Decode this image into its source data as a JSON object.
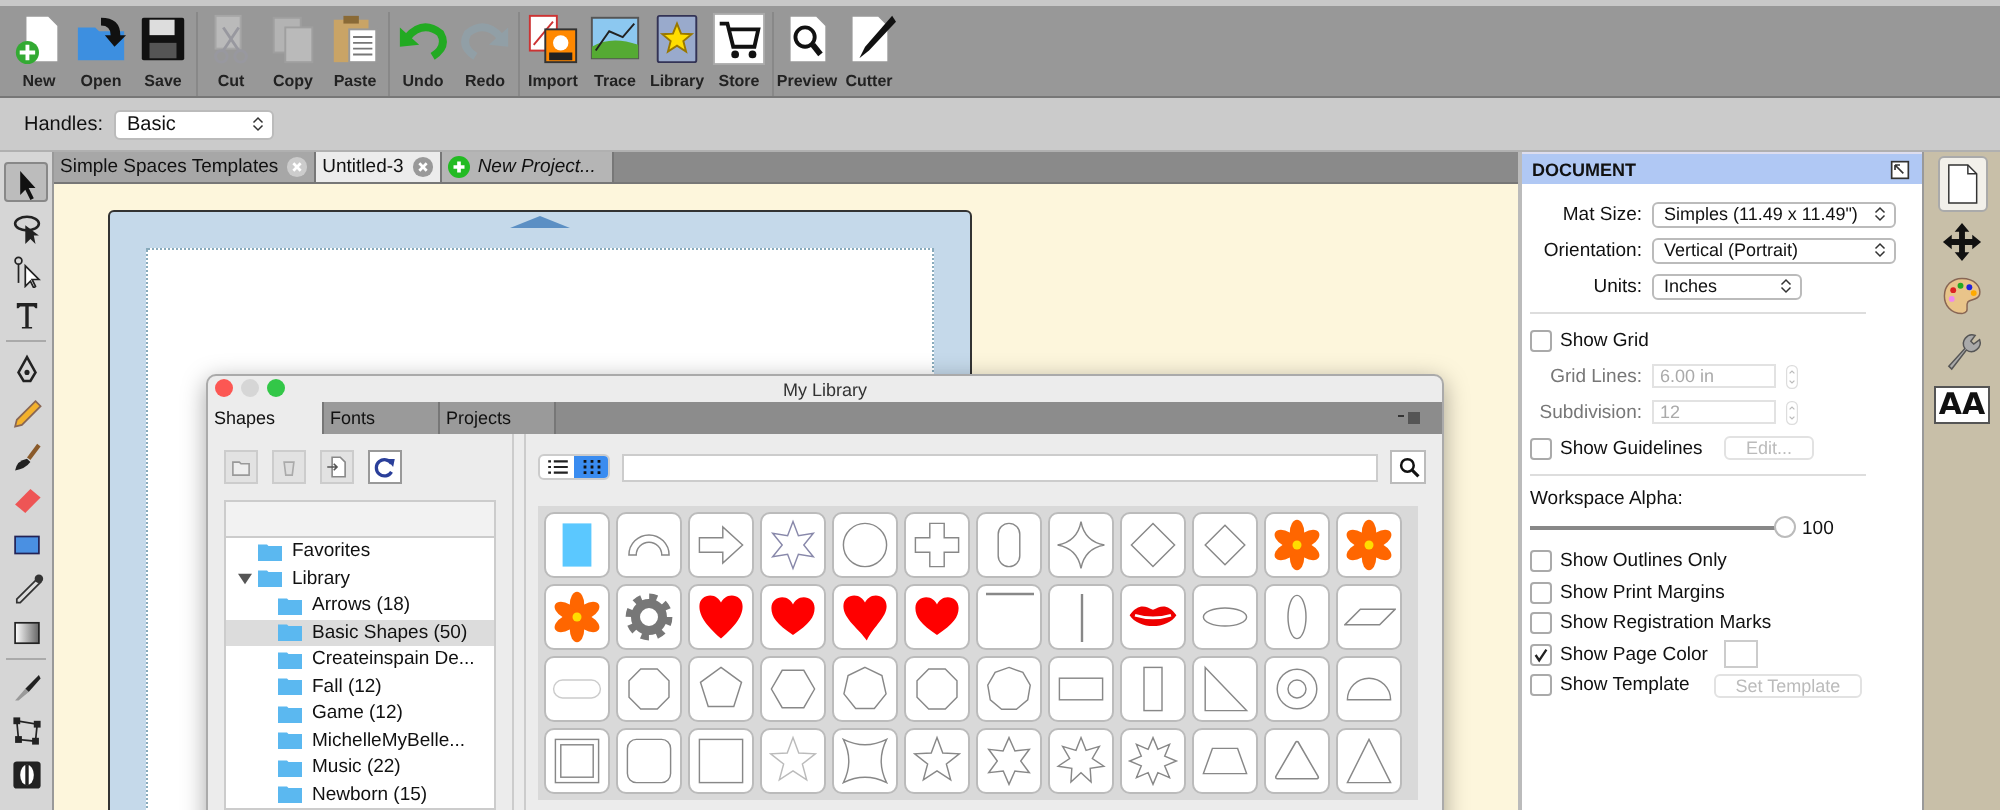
{
  "toolbar": [
    {
      "label": "New",
      "kind": "new",
      "disabled": false
    },
    {
      "label": "Open",
      "kind": "open",
      "disabled": false
    },
    {
      "label": "Save",
      "kind": "save",
      "disabled": false
    },
    {
      "label": "Cut",
      "kind": "cut",
      "disabled": true
    },
    {
      "label": "Copy",
      "kind": "copy",
      "disabled": true
    },
    {
      "label": "Paste",
      "kind": "paste",
      "disabled": false
    },
    {
      "label": "Undo",
      "kind": "undo",
      "disabled": false
    },
    {
      "label": "Redo",
      "kind": "redo",
      "disabled": true
    },
    {
      "label": "Import",
      "kind": "import",
      "disabled": false
    },
    {
      "label": "Trace",
      "kind": "trace",
      "disabled": false
    },
    {
      "label": "Library",
      "kind": "library",
      "disabled": false
    },
    {
      "label": "Store",
      "kind": "store",
      "disabled": false
    },
    {
      "label": "Preview",
      "kind": "preview",
      "disabled": false
    },
    {
      "label": "Cutter",
      "kind": "cutter",
      "disabled": false
    }
  ],
  "handles": {
    "label": "Handles:",
    "value": "Basic"
  },
  "tools": [
    {
      "kind": "pointer",
      "selected": true
    },
    {
      "kind": "lasso",
      "selected": false
    },
    {
      "kind": "node",
      "selected": false
    },
    {
      "kind": "text",
      "selected": false
    },
    {
      "kind": "pen",
      "selected": false
    },
    {
      "kind": "pencil",
      "selected": false
    },
    {
      "kind": "brush",
      "selected": false
    },
    {
      "kind": "eraser",
      "selected": false
    },
    {
      "kind": "rectangle",
      "selected": false
    },
    {
      "kind": "eyedropper",
      "selected": false
    },
    {
      "kind": "gradient",
      "selected": false
    },
    {
      "kind": "knife",
      "selected": false
    },
    {
      "kind": "transform",
      "selected": false
    },
    {
      "kind": "weld",
      "selected": false
    }
  ],
  "document_tabs": [
    {
      "label": "Simple Spaces Templates",
      "kind": "doc",
      "selected": false
    },
    {
      "label": "Untitled-3",
      "kind": "doc",
      "selected": true
    },
    {
      "label": "New Project...",
      "kind": "new",
      "selected": false
    }
  ],
  "library_window": {
    "title": "My Library",
    "tabs": [
      {
        "label": "Shapes",
        "selected": true
      },
      {
        "label": "Fonts",
        "selected": false
      },
      {
        "label": "Projects",
        "selected": false
      }
    ],
    "tree": [
      {
        "label": "Favorites",
        "selected": false
      },
      {
        "label": "Library",
        "selected": false,
        "expanded": true,
        "children": [
          {
            "label": "Arrows (18)",
            "selected": false
          },
          {
            "label": "Basic Shapes (50)",
            "selected": true
          },
          {
            "label": "Createinspain De...",
            "selected": false
          },
          {
            "label": "Fall (12)",
            "selected": false
          },
          {
            "label": "Game (12)",
            "selected": false
          },
          {
            "label": "MichelleMyBelle...",
            "selected": false
          },
          {
            "label": "Music (22)",
            "selected": false
          },
          {
            "label": "Newborn (15)",
            "selected": false
          }
        ]
      }
    ],
    "views": [
      {
        "kind": "list",
        "selected": false
      },
      {
        "kind": "grid",
        "selected": true
      }
    ]
  },
  "document_panel": {
    "title": "DOCUMENT",
    "selects": [
      {
        "label": "Mat Size:",
        "value": "Simples (11.49 x 11.49\")"
      },
      {
        "label": "Orientation:",
        "value": "Vertical (Portrait)"
      },
      {
        "label": "Units:",
        "value": "Inches"
      }
    ],
    "show_grid": {
      "label": "Show Grid",
      "checked": false
    },
    "fields": [
      {
        "label": "Grid Lines:",
        "value": "6.00 in",
        "disabled": true
      },
      {
        "label": "Subdivision:",
        "value": "12",
        "disabled": true
      }
    ],
    "show_guidelines": {
      "label": "Show Guidelines",
      "checked": false,
      "button": "Edit...",
      "button_disabled": true
    },
    "alpha": {
      "label": "Workspace Alpha:",
      "level": 1.0,
      "reading": "100"
    },
    "options": [
      {
        "label": "Show Outlines Only",
        "checked": false,
        "kind": "plain"
      },
      {
        "label": "Show Print Margins",
        "checked": false,
        "kind": "plain"
      },
      {
        "label": "Show Registration Marks",
        "checked": false,
        "kind": "plain"
      },
      {
        "label": "Show Page Color",
        "checked": true,
        "kind": "swatch"
      },
      {
        "label": "Show Template",
        "checked": false,
        "kind": "button",
        "button": "Set Template",
        "button_disabled": true
      }
    ]
  },
  "side_tabs": [
    {
      "kind": "page",
      "selected": true
    },
    {
      "kind": "move",
      "selected": false
    },
    {
      "kind": "palette",
      "selected": false
    },
    {
      "kind": "wrench",
      "selected": false
    },
    {
      "kind": "text",
      "selected": false,
      "glyph": "AA"
    }
  ]
}
